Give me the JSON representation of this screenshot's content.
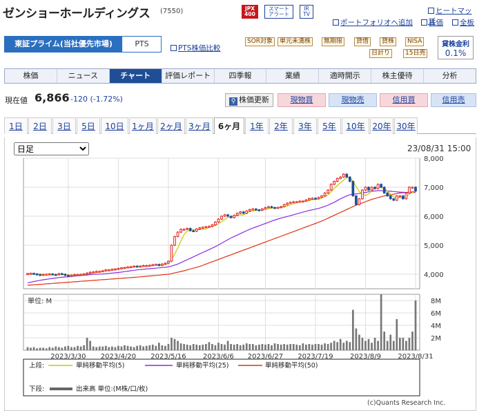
{
  "header": {
    "company": "ゼンショーホールディングス",
    "code": "(7550)",
    "badges": {
      "jpx": "JPX\n400",
      "smart": "スマート\nアラート",
      "ir": "IR\nTV"
    },
    "links": {
      "heatmap": "ヒートマップ",
      "portfolio": "ポートフォリオへ追加",
      "stock": "株価",
      "all": "全板"
    }
  },
  "market": {
    "active": "東証プライム(当社優先市場)",
    "pts": "PTS",
    "pts_compare": "PTS株価比較"
  },
  "tags": [
    "SOR対象",
    "単元未満株",
    "無期限",
    "貸借",
    "貸株",
    "NISA",
    "日計り",
    "15日売"
  ],
  "lending": {
    "title": "貸株金利",
    "value": "0.1%"
  },
  "tabs": [
    "株価",
    "ニュース",
    "チャート",
    "評価レポート",
    "四季報",
    "業績",
    "適時開示",
    "株主優待",
    "分析"
  ],
  "quote": {
    "label": "現在値",
    "price": "6,866",
    "change": "-120 (-1.72%)"
  },
  "buttons": {
    "refresh": "株価更新",
    "spot_buy": "現物買",
    "spot_sell": "現物売",
    "margin_buy": "信用買",
    "margin_sell": "信用売"
  },
  "periods": [
    "1日",
    "2日",
    "3日",
    "5日",
    "10日",
    "1ヶ月",
    "2ヶ月",
    "3ヶ月",
    "6ヶ月",
    "1年",
    "2年",
    "3年",
    "5年",
    "10年",
    "20年",
    "30年"
  ],
  "active_period": "6ヶ月",
  "chart": {
    "interval_select": "日足",
    "datetime": "23/08/31 15:00",
    "volume_unit_label": "単位: M",
    "legend_upper_label": "上段:",
    "legend_lower_label": "下段:",
    "legend": [
      {
        "name": "単純移動平均(5)",
        "color": "#c8c800"
      },
      {
        "name": "単純移動平均(25)",
        "color": "#8a2be2"
      },
      {
        "name": "単純移動平均(50)",
        "color": "#e03010"
      }
    ],
    "volume_legend": "出来高 単位:(M株/口/枚)",
    "credit": "(c)Quants Research Inc.",
    "up_color": "#e02020",
    "down_color": "#1f4e96"
  },
  "chart_data": {
    "type": "line",
    "x_ticks": [
      "2023/3/30",
      "2023/4/20",
      "2023/5/16",
      "2023/6/6",
      "2023/6/27",
      "2023/7/19",
      "2023/8/9",
      "2023/8/31"
    ],
    "price_ylim": [
      3500,
      8000
    ],
    "price_yticks": [
      "8,000",
      "7,000",
      "6,000",
      "5,000",
      "4,000"
    ],
    "volume_ylim": [
      0,
      9
    ],
    "volume_yticks": [
      "8M",
      "6M",
      "4M",
      "2M"
    ],
    "close": [
      4020,
      4030,
      4010,
      3990,
      3980,
      3990,
      4000,
      4010,
      3990,
      3980,
      4020,
      4000,
      3960,
      3930,
      3960,
      3990,
      3990,
      4000,
      4010,
      4040,
      4070,
      4080,
      4100,
      4100,
      4120,
      4150,
      4150,
      4170,
      4180,
      4200,
      4220,
      4230,
      4250,
      4260,
      4280,
      4260,
      4280,
      4300,
      4300,
      4310,
      4330,
      4340,
      4300,
      4350,
      4380,
      4450,
      5000,
      5300,
      5450,
      5550,
      5550,
      5580,
      5500,
      5480,
      5560,
      5600,
      5620,
      5640,
      5650,
      5700,
      5800,
      5900,
      6000,
      6050,
      6000,
      5950,
      6030,
      6100,
      6150,
      6100,
      6180,
      6230,
      6250,
      6220,
      6200,
      6250,
      6300,
      6330,
      6300,
      6280,
      6300,
      6330,
      6400,
      6450,
      6480,
      6500,
      6500,
      6520,
      6520,
      6560,
      6610,
      6620,
      6600,
      6650,
      6700,
      6800,
      6900,
      7100,
      7200,
      7300,
      7350,
      7450,
      7350,
      7200,
      6700,
      6400,
      6600,
      6900,
      7000,
      6900,
      7000,
      6950,
      7100,
      7000,
      6800,
      6700,
      6600,
      6550,
      6700,
      6700,
      6600,
      6800,
      7000,
      7000,
      6866
    ],
    "ma5": [
      4020,
      4025,
      4020,
      4012,
      4006,
      4000,
      3998,
      4000,
      3996,
      3994,
      3998,
      4000,
      3994,
      3978,
      3974,
      3968,
      3966,
      3976,
      3990,
      4006,
      4022,
      4040,
      4060,
      4078,
      4094,
      4120,
      4136,
      4154,
      4170,
      4182,
      4206,
      4216,
      4228,
      4242,
      4252,
      4268,
      4270,
      4276,
      4284,
      4290,
      4302,
      4316,
      4318,
      4324,
      4340,
      4364,
      4496,
      4696,
      4900,
      5150,
      5370,
      5486,
      5526,
      5534,
      5536,
      5538,
      5552,
      5560,
      5614,
      5642,
      5682,
      5738,
      5810,
      5890,
      5960,
      5980,
      6006,
      6026,
      6046,
      6046,
      6112,
      6152,
      6182,
      6196,
      6216,
      6230,
      6244,
      6260,
      6276,
      6292,
      6296,
      6308,
      6322,
      6352,
      6392,
      6432,
      6470,
      6490,
      6508,
      6524,
      6542,
      6566,
      6576,
      6594,
      6628,
      6674,
      6734,
      6840,
      6960,
      7060,
      7150,
      7250,
      7330,
      7330,
      7210,
      7020,
      6850,
      6760,
      6720,
      6760,
      6880,
      6950,
      6990,
      6990,
      6950,
      6870,
      6760,
      6670,
      6620,
      6650,
      6640,
      6670,
      6760,
      6820,
      6853
    ],
    "ma25": [
      3700,
      3725,
      3750,
      3770,
      3790,
      3810,
      3825,
      3840,
      3855,
      3870,
      3885,
      3895,
      3905,
      3915,
      3925,
      3935,
      3945,
      3955,
      3965,
      3975,
      3985,
      3995,
      4000,
      4005,
      4010,
      4020,
      4030,
      4040,
      4050,
      4060,
      4075,
      4090,
      4105,
      4120,
      4135,
      4150,
      4160,
      4170,
      4180,
      4190,
      4200,
      4210,
      4220,
      4230,
      4240,
      4255,
      4280,
      4315,
      4350,
      4400,
      4450,
      4500,
      4550,
      4600,
      4650,
      4700,
      4750,
      4800,
      4850,
      4900,
      4950,
      5010,
      5070,
      5130,
      5190,
      5250,
      5300,
      5350,
      5400,
      5450,
      5500,
      5550,
      5590,
      5630,
      5670,
      5710,
      5750,
      5790,
      5830,
      5870,
      5905,
      5935,
      5960,
      5990,
      6020,
      6050,
      6080,
      6110,
      6140,
      6170,
      6200,
      6220,
      6245,
      6270,
      6300,
      6340,
      6380,
      6430,
      6480,
      6540,
      6600,
      6650,
      6700,
      6740,
      6760,
      6770,
      6780,
      6800,
      6820,
      6840,
      6860,
      6870,
      6880,
      6880,
      6875,
      6870,
      6860,
      6850,
      6840,
      6830,
      6825,
      6820,
      6820,
      6820,
      6815
    ],
    "ma50": [
      3620,
      3628,
      3636,
      3644,
      3652,
      3660,
      3668,
      3676,
      3684,
      3692,
      3700,
      3708,
      3716,
      3724,
      3732,
      3740,
      3748,
      3756,
      3764,
      3772,
      3780,
      3788,
      3796,
      3804,
      3812,
      3820,
      3828,
      3836,
      3844,
      3852,
      3860,
      3868,
      3876,
      3884,
      3892,
      3900,
      3910,
      3920,
      3930,
      3940,
      3950,
      3960,
      3970,
      3980,
      3990,
      4000,
      4020,
      4045,
      4070,
      4095,
      4120,
      4150,
      4180,
      4210,
      4240,
      4270,
      4310,
      4350,
      4390,
      4430,
      4470,
      4510,
      4550,
      4590,
      4630,
      4670,
      4710,
      4750,
      4790,
      4830,
      4870,
      4910,
      4950,
      4990,
      5030,
      5070,
      5110,
      5150,
      5190,
      5230,
      5270,
      5310,
      5350,
      5390,
      5430,
      5470,
      5510,
      5550,
      5590,
      5630,
      5670,
      5710,
      5750,
      5790,
      5830,
      5880,
      5930,
      5980,
      6030,
      6080,
      6130,
      6180,
      6230,
      6280,
      6330,
      6380,
      6420,
      6460,
      6500,
      6540,
      6580,
      6610,
      6640,
      6670,
      6700,
      6720,
      6740,
      6760,
      6780,
      6800,
      6810,
      6820,
      6830,
      6840,
      6850
    ],
    "volume": [
      0.5,
      0.4,
      0.5,
      0.3,
      0.4,
      0.4,
      0.3,
      0.5,
      0.4,
      0.6,
      0.5,
      0.4,
      0.6,
      0.7,
      0.5,
      0.5,
      0.7,
      0.6,
      0.8,
      2.0,
      1.5,
      0.6,
      0.5,
      0.6,
      0.6,
      0.7,
      0.5,
      0.6,
      0.5,
      0.7,
      0.6,
      0.8,
      0.7,
      0.6,
      0.5,
      0.7,
      0.8,
      0.6,
      0.7,
      0.8,
      0.9,
      0.7,
      1.2,
      0.8,
      0.7,
      1.0,
      2.0,
      1.8,
      1.5,
      1.1,
      1.0,
      0.9,
      0.8,
      1.0,
      0.9,
      0.8,
      0.9,
      1.0,
      1.3,
      1.0,
      0.8,
      1.2,
      1.0,
      0.9,
      1.5,
      1.0,
      0.9,
      1.0,
      0.8,
      0.9,
      1.1,
      1.0,
      1.0,
      0.8,
      0.9,
      1.0,
      0.9,
      1.0,
      0.8,
      1.1,
      1.0,
      0.9,
      1.0,
      0.9,
      1.0,
      1.0,
      0.9,
      0.8,
      1.1,
      0.9,
      1.0,
      0.9,
      1.0,
      1.0,
      0.9,
      1.1,
      1.0,
      1.2,
      1.5,
      1.3,
      1.8,
      1.2,
      1.5,
      1.3,
      6.5,
      3.5,
      2.5,
      2.0,
      1.5,
      1.8,
      1.2,
      2.0,
      1.5,
      9.0,
      3.0,
      1.5,
      2.5,
      1.5,
      5.0,
      2.0,
      2.0,
      1.5,
      2.0,
      3.0,
      8.0
    ]
  }
}
